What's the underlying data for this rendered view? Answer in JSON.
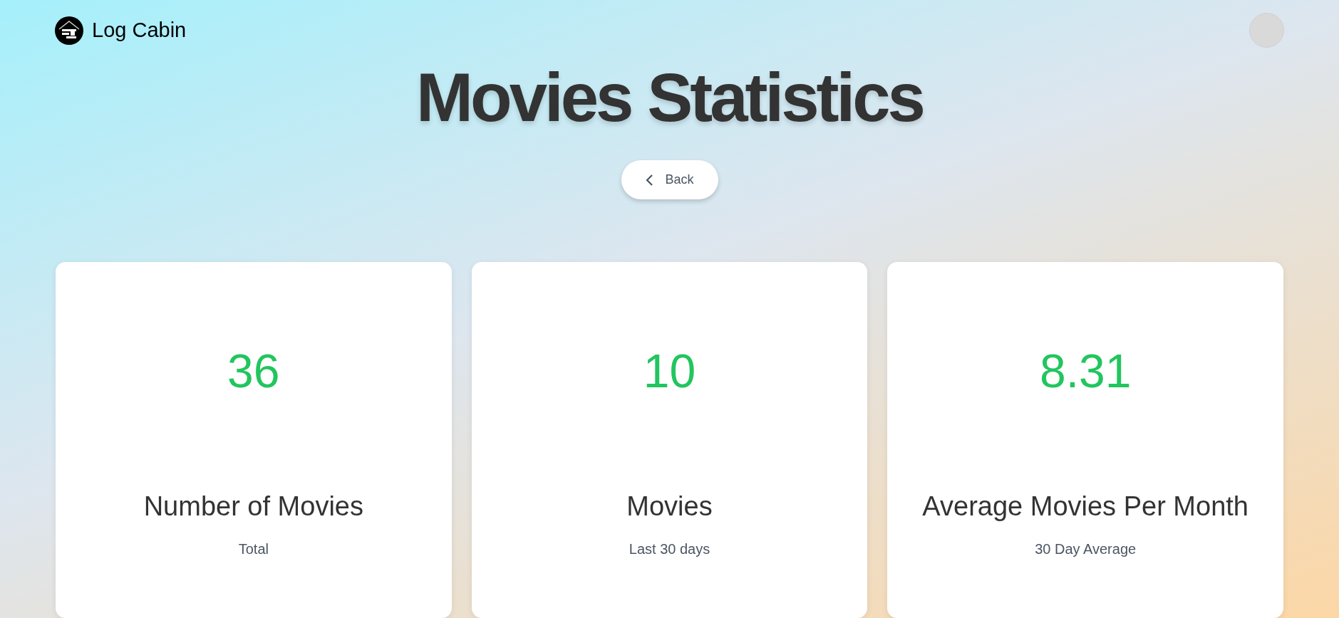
{
  "header": {
    "brand": "Log Cabin"
  },
  "title": "Movies Statistics",
  "back_button": {
    "label": "Back"
  },
  "stats": [
    {
      "value": "36",
      "label": "Number of Movies",
      "caption": "Total"
    },
    {
      "value": "10",
      "label": "Movies",
      "caption": "Last 30 days"
    },
    {
      "value": "8.31",
      "label": "Average Movies Per Month",
      "caption": "30 Day Average"
    }
  ]
}
